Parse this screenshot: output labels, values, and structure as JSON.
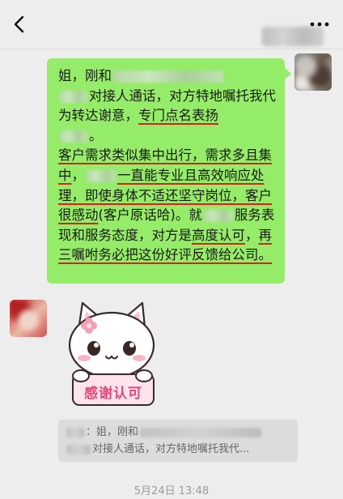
{
  "header": {
    "back_icon": "chevron-left-icon",
    "more_icon": "more-dots-icon"
  },
  "message": {
    "part1": "姐，刚和",
    "part2": "对接人通话，对方特地嘱托我代为转达谢意，",
    "part3_ul": "专门点名表扬",
    "part4": "。",
    "part5_ul": "客户需求类似集中出行，需求多且集中",
    "part6": "，",
    "part7_ul": "一直能专业且高效响应处理，即使身体不适还坚守岗位，客户很感动",
    "part8": "(客户原话哈)。就",
    "part9": "服务表现和服务态度，对方是",
    "part10_ul": "高度认可",
    "part11": "，",
    "part12_ul": "再三嘱咐务必把这份好评反馈给公司。"
  },
  "sticker": {
    "text": "感谢认可"
  },
  "quote": {
    "line1_prefix": "：姐，刚和",
    "line2": "对接人通话，对方特地嘱托我代..."
  },
  "timestamp": "5月24日 13:48",
  "colors": {
    "bubble": "#95ec69",
    "underline": "#e01e1e",
    "background": "#ededed"
  }
}
